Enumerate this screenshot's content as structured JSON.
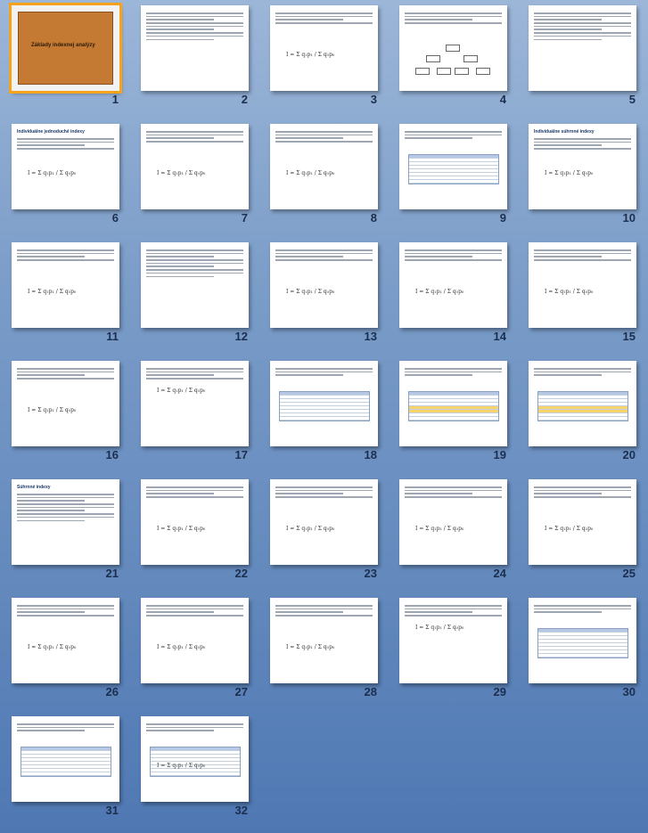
{
  "slides": [
    {
      "number": "1",
      "title": "Základy indexnej analýzy",
      "kind": "title",
      "selected": true
    },
    {
      "number": "2",
      "kind": "text"
    },
    {
      "number": "3",
      "kind": "text-formula"
    },
    {
      "number": "4",
      "kind": "diagram"
    },
    {
      "number": "5",
      "kind": "text"
    },
    {
      "number": "6",
      "title": "Individuálne jednoduché indexy",
      "kind": "text-formula"
    },
    {
      "number": "7",
      "kind": "text-formula"
    },
    {
      "number": "8",
      "kind": "text-formula"
    },
    {
      "number": "9",
      "kind": "table"
    },
    {
      "number": "10",
      "title": "Individuálne súhrnné indexy",
      "kind": "text-formula"
    },
    {
      "number": "11",
      "kind": "text-formula"
    },
    {
      "number": "12",
      "kind": "text"
    },
    {
      "number": "13",
      "kind": "text-formula"
    },
    {
      "number": "14",
      "kind": "text-formula"
    },
    {
      "number": "15",
      "kind": "text-formula"
    },
    {
      "number": "16",
      "kind": "text-formula"
    },
    {
      "number": "17",
      "kind": "formula"
    },
    {
      "number": "18",
      "kind": "table"
    },
    {
      "number": "19",
      "kind": "table-colored"
    },
    {
      "number": "20",
      "kind": "table-colored"
    },
    {
      "number": "21",
      "title": "Súhrnné indexy",
      "kind": "text"
    },
    {
      "number": "22",
      "kind": "text-formula"
    },
    {
      "number": "23",
      "kind": "text-formula"
    },
    {
      "number": "24",
      "kind": "text-formula"
    },
    {
      "number": "25",
      "kind": "text-formula"
    },
    {
      "number": "26",
      "kind": "text-formula"
    },
    {
      "number": "27",
      "kind": "text-formula"
    },
    {
      "number": "28",
      "kind": "text-formula"
    },
    {
      "number": "29",
      "kind": "formula"
    },
    {
      "number": "30",
      "kind": "table"
    },
    {
      "number": "31",
      "kind": "table"
    },
    {
      "number": "32",
      "kind": "table-formula"
    }
  ]
}
